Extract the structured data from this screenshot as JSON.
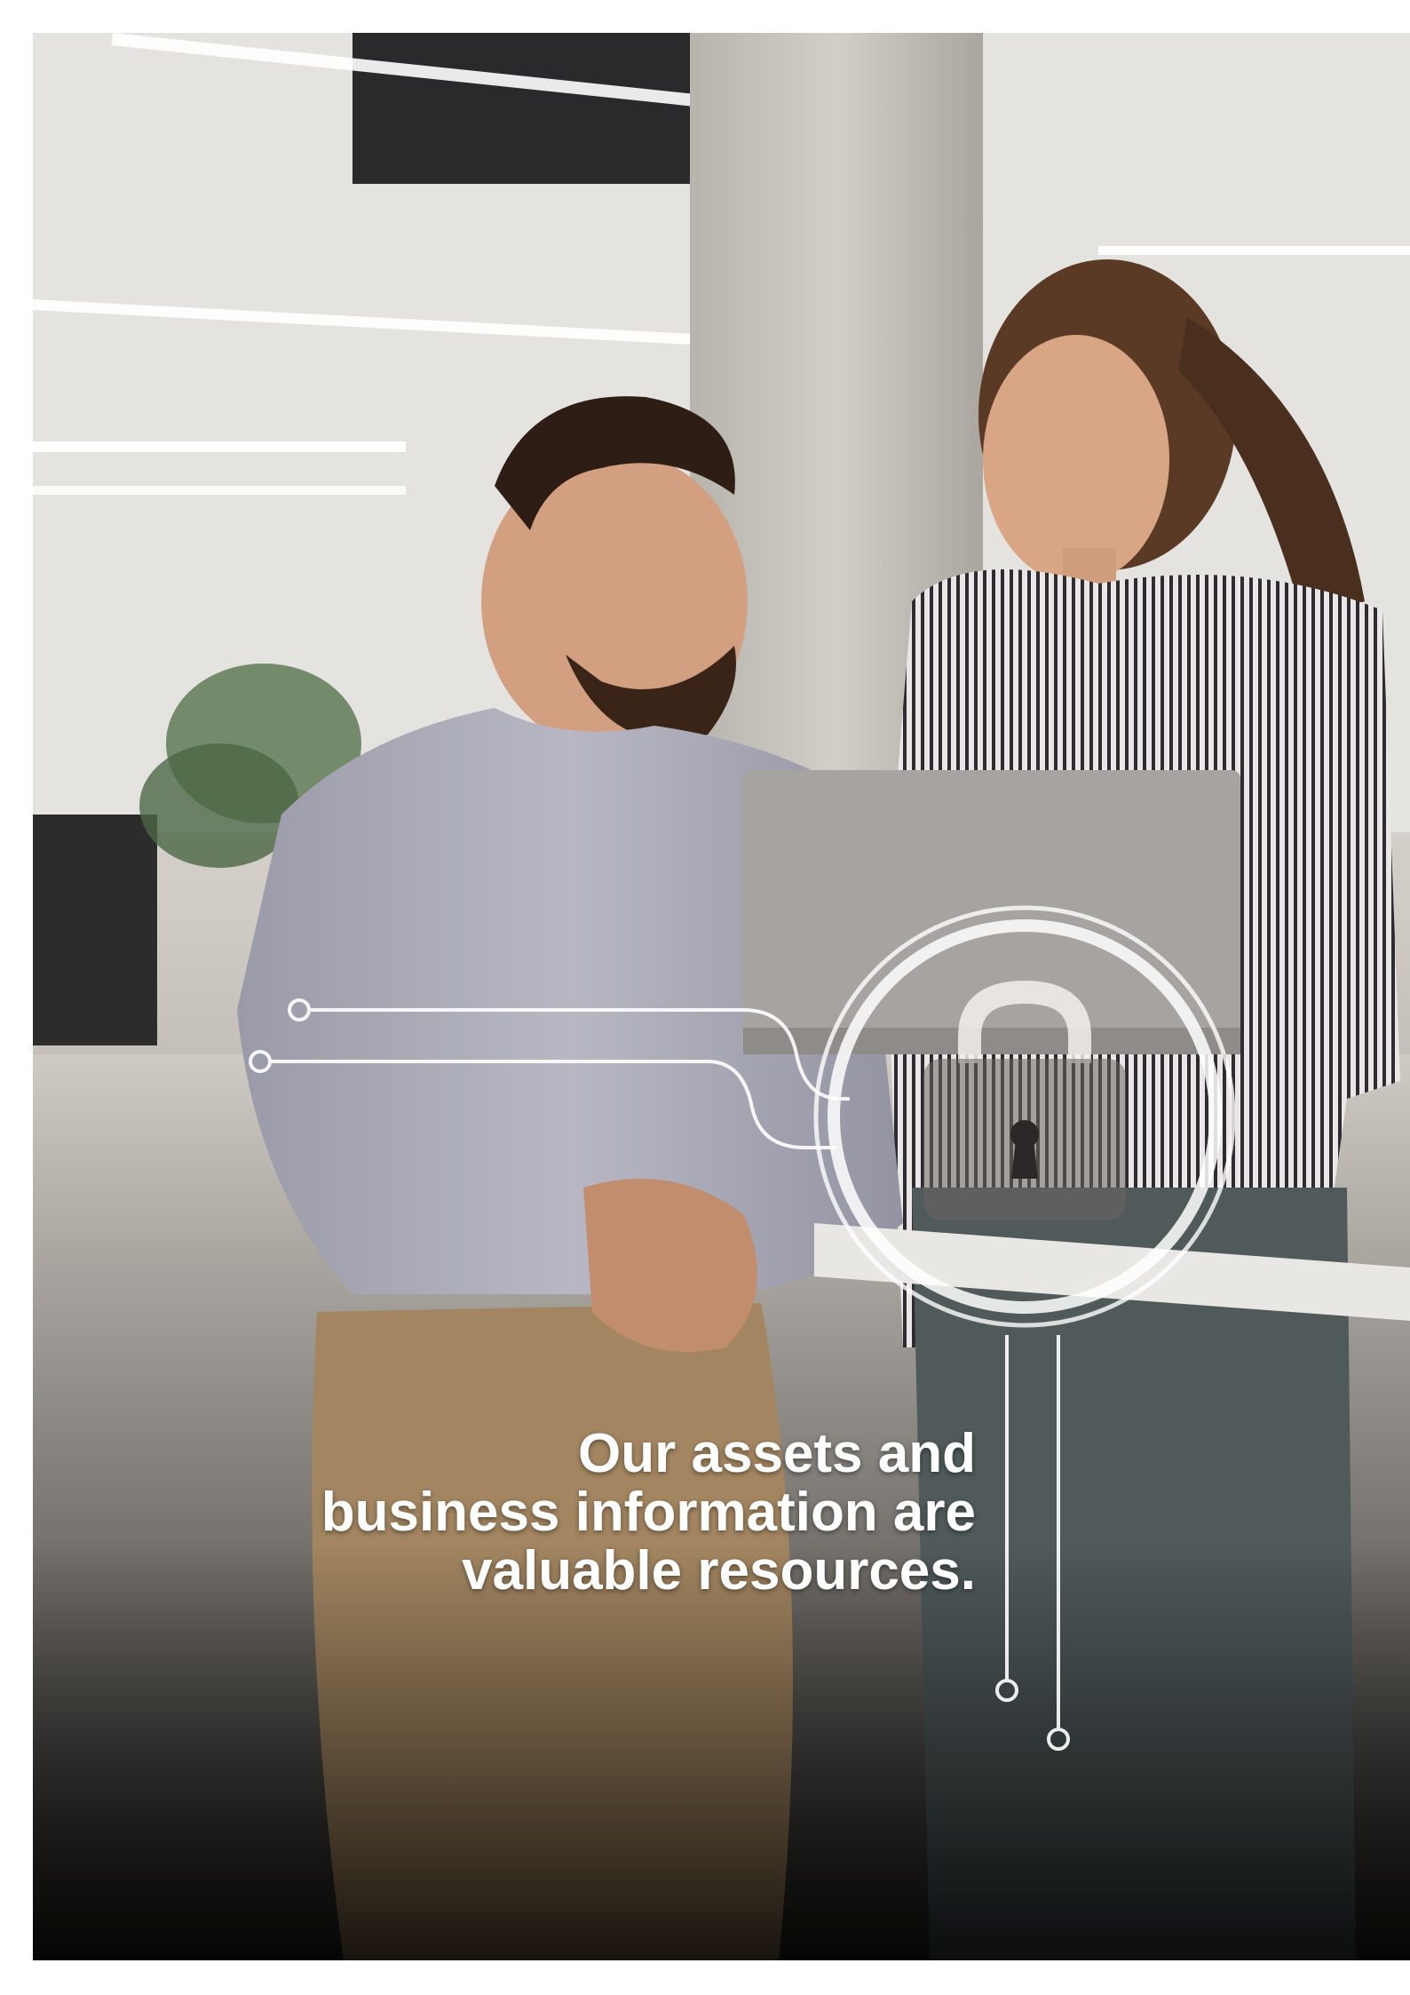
{
  "headline": {
    "line1": "Our assets and",
    "line2": "business information are",
    "line3": "valuable resources."
  },
  "colors": {
    "text": "#ffffff",
    "overlay_lines": "#ffffff",
    "page_background": "#ffffff"
  },
  "icons": {
    "lock": "padlock-icon",
    "circuit_lines": "circuit-connector-lines"
  }
}
